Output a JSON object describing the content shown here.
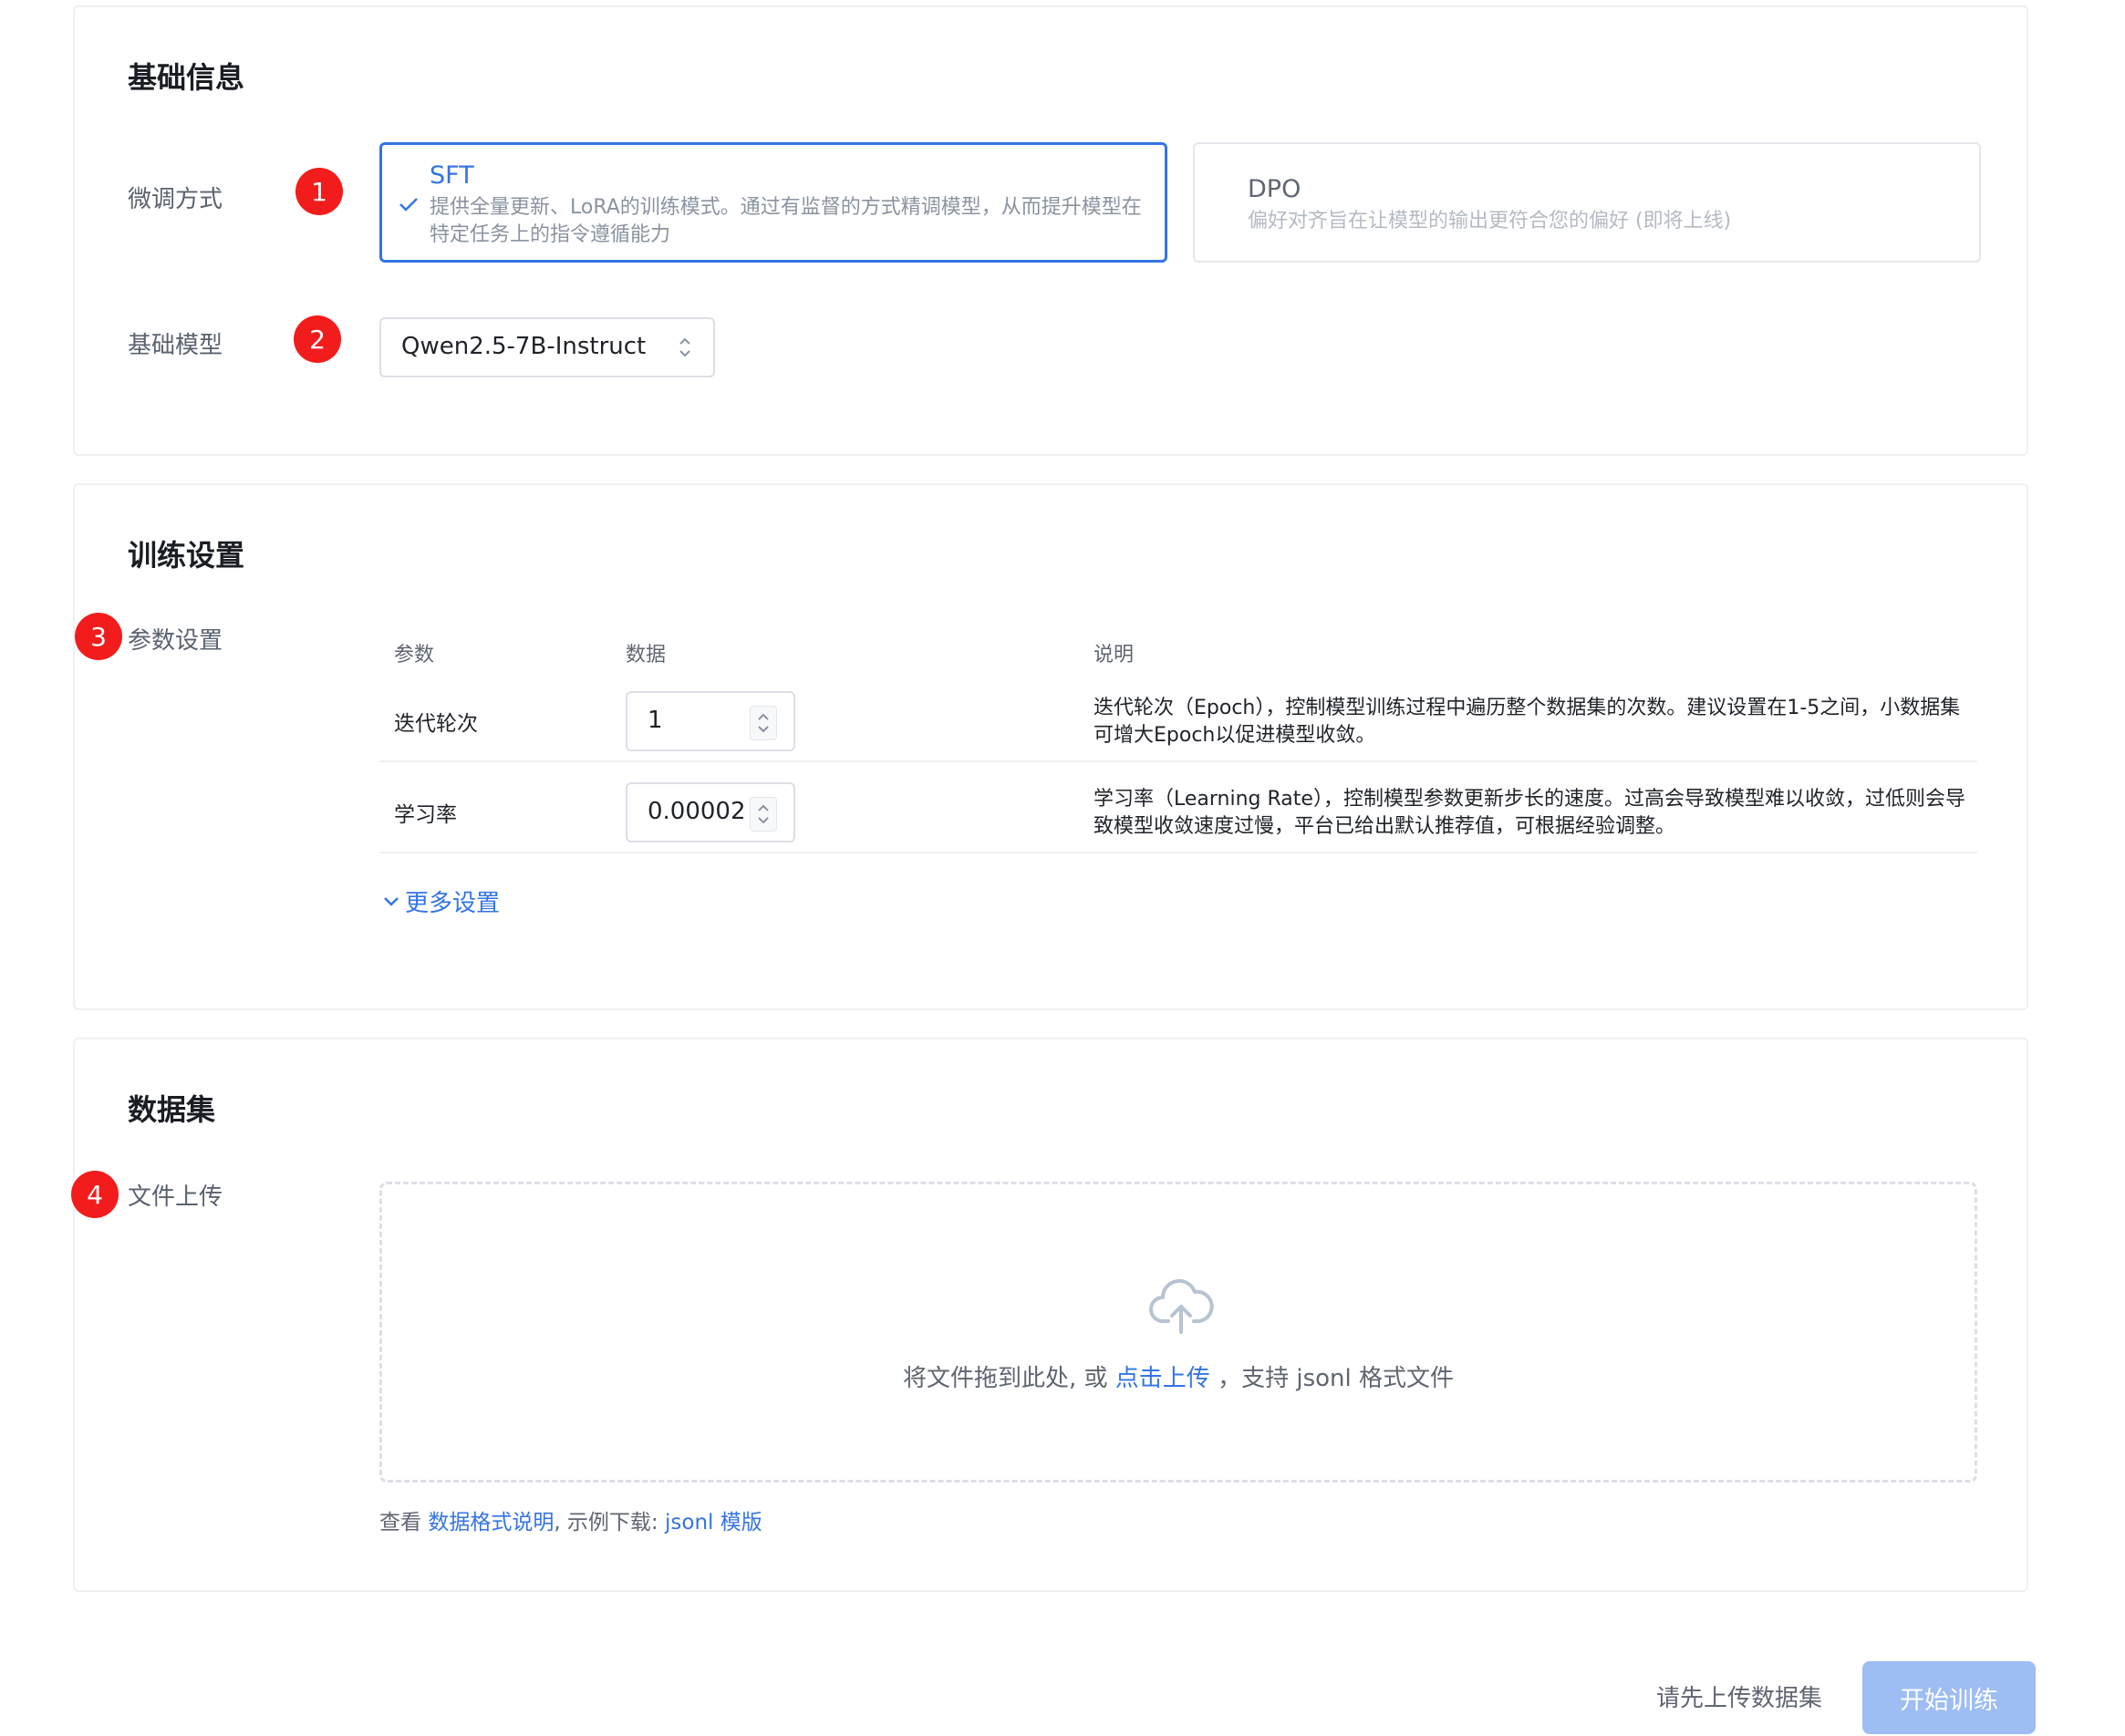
{
  "basic_info": {
    "title": "基础信息",
    "method_label": "微调方式",
    "model_label": "基础模型",
    "methods": [
      {
        "name": "SFT",
        "description": "提供全量更新、LoRA的训练模式。通过有监督的方式精调模型，从而提升模型在特定任务上的指令遵循能力",
        "selected": true
      },
      {
        "name": "DPO",
        "description": "偏好对齐旨在让模型的输出更符合您的偏好 (即将上线)",
        "selected": false
      }
    ],
    "model_value": "Qwen2.5-7B-Instruct"
  },
  "training": {
    "title": "训练设置",
    "param_label": "参数设置",
    "columns": [
      "参数",
      "数据",
      "说明"
    ],
    "rows": [
      {
        "name": "迭代轮次",
        "value": "1",
        "description": "迭代轮次（Epoch），控制模型训练过程中遍历整个数据集的次数。建议设置在1-5之间，小数据集可增大Epoch以促进模型收敛。"
      },
      {
        "name": "学习率",
        "value": "0.00002",
        "description": "学习率（Learning Rate），控制模型参数更新步长的速度。过高会导致模型难以收敛，过低则会导致模型收敛速度过慢，平台已给出默认推荐值，可根据经验调整。"
      }
    ],
    "more_settings": "更多设置"
  },
  "dataset": {
    "title": "数据集",
    "upload_label": "文件上传",
    "drop_text_before": "将文件拖到此处, 或 ",
    "drop_link": "点击上传",
    "drop_text_after": " ，支持 jsonl 格式文件",
    "hint_prefix": "查看 ",
    "hint_link1": "数据格式说明",
    "hint_middle": ", 示例下载: ",
    "hint_link2": "jsonl 模版"
  },
  "badges": [
    "1",
    "2",
    "3",
    "4"
  ],
  "footer": {
    "status": "请先上传数据集",
    "start_button": "开始训练"
  },
  "colors": {
    "accent": "#3474e5",
    "badge": "#f31c1c",
    "button_disabled": "#9dbdf3"
  }
}
